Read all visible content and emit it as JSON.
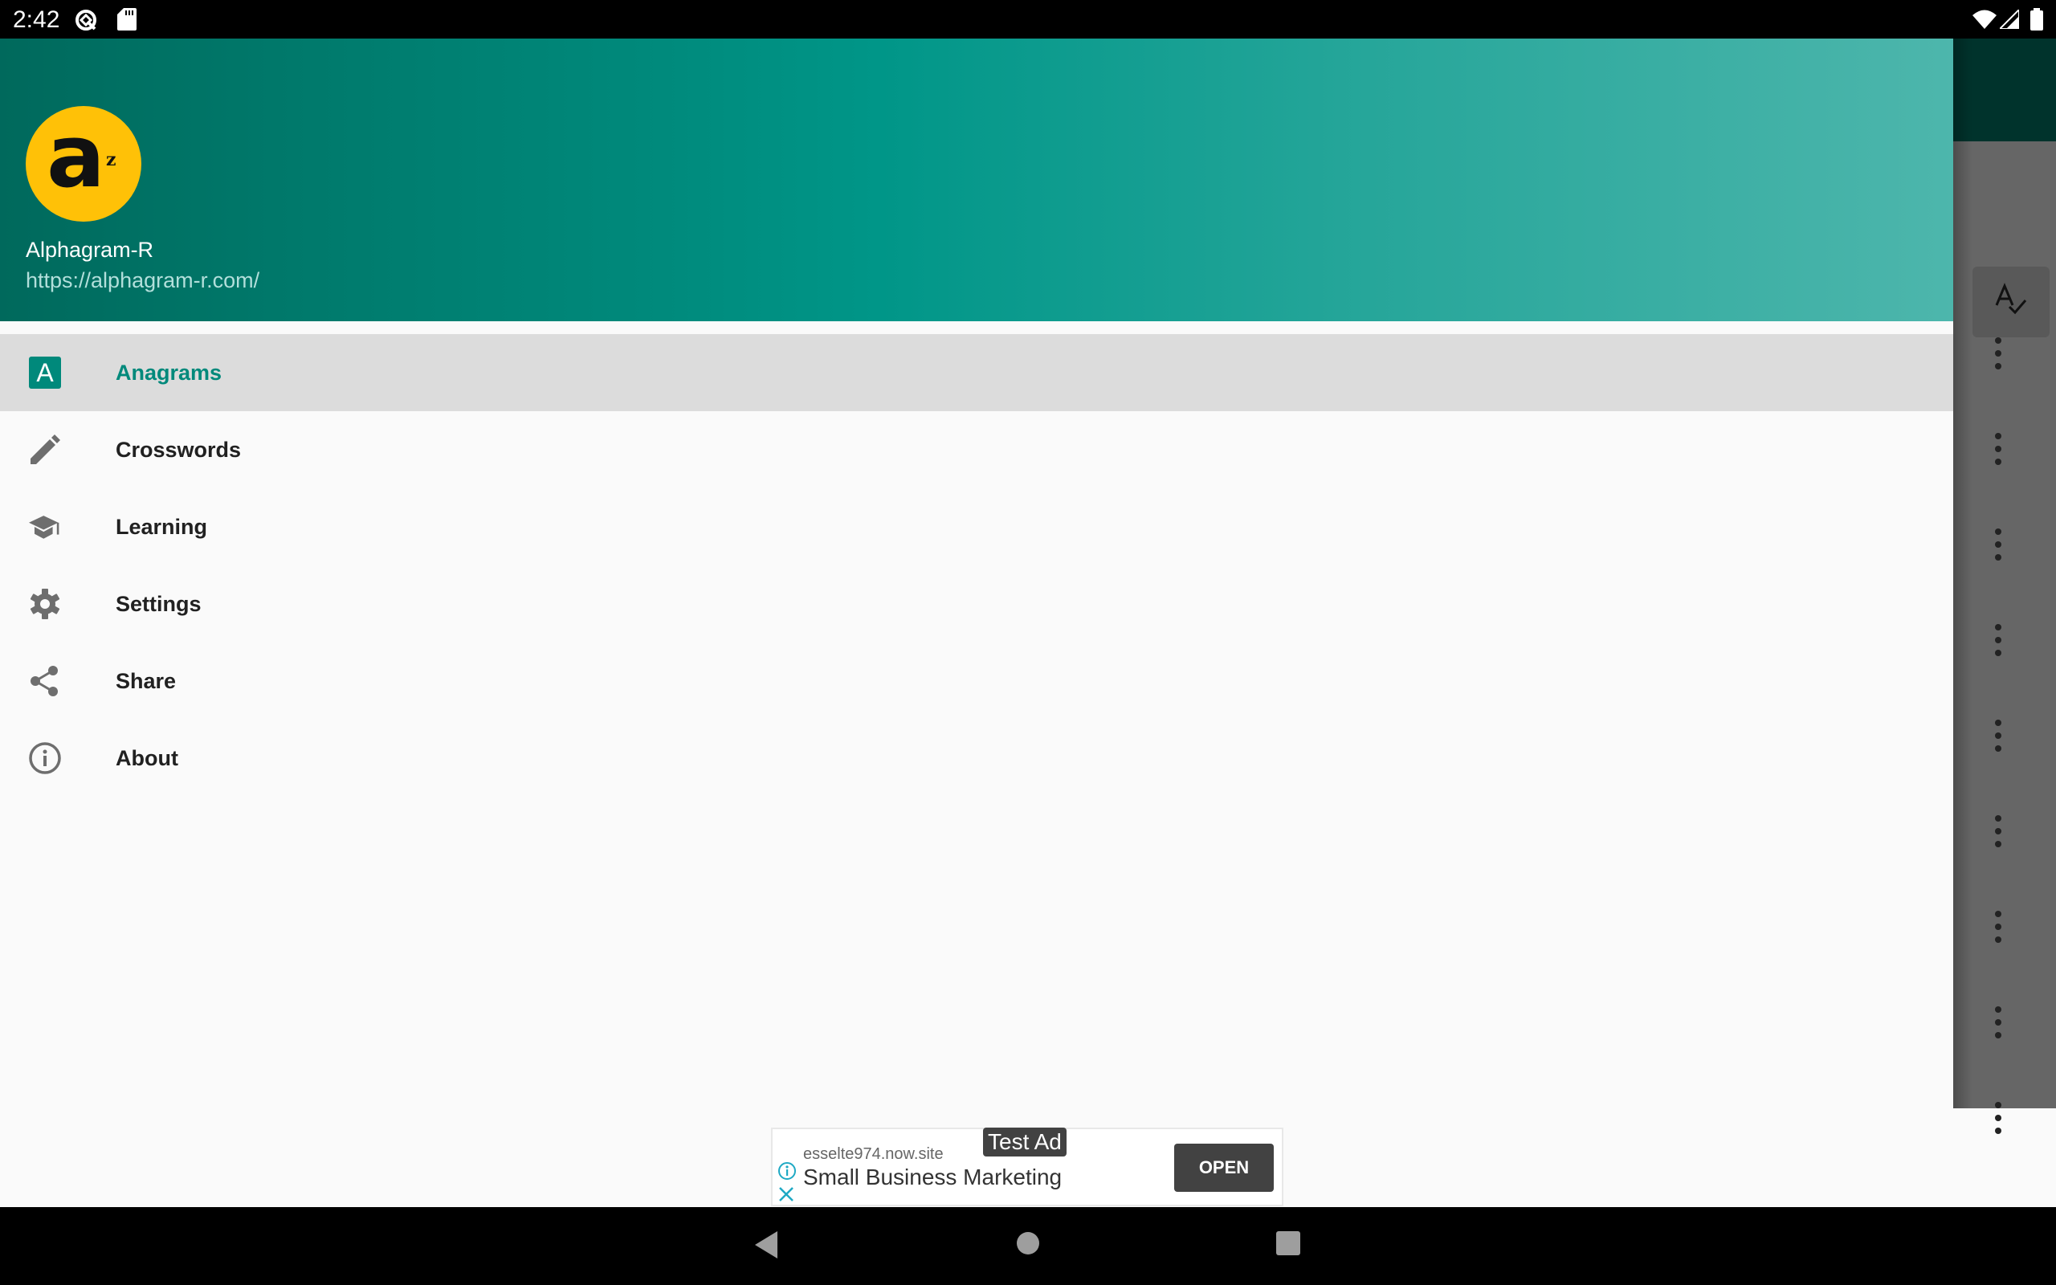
{
  "status_bar": {
    "time": "2:42",
    "left_icons": [
      "vpn-key-icon",
      "sd-card-icon"
    ],
    "right_icons": [
      "wifi-icon",
      "cell-signal-icon",
      "battery-icon"
    ]
  },
  "drawer": {
    "header": {
      "app_name": "Alphagram-R",
      "url": "https://alphagram-r.com/",
      "avatar": {
        "letter": "a",
        "superscript": "z",
        "color": "#ffc107"
      },
      "gradient_colors": [
        "#00695c",
        "#009688",
        "#4db6ac"
      ]
    },
    "menu": [
      {
        "label": "Anagrams",
        "icon": "anagram-a-icon",
        "selected": true
      },
      {
        "label": "Crosswords",
        "icon": "pencil-icon",
        "selected": false
      },
      {
        "label": "Learning",
        "icon": "school-icon",
        "selected": false
      },
      {
        "label": "Settings",
        "icon": "gear-icon",
        "selected": false
      },
      {
        "label": "Share",
        "icon": "share-icon",
        "selected": false
      },
      {
        "label": "About",
        "icon": "info-icon",
        "selected": false
      }
    ],
    "accent_color": "#00897b",
    "anagram_icon_letter": "A"
  },
  "background_app": {
    "toolbar_icon": "spellcheck-icon",
    "row_menu_icon": "more-vert-icon",
    "row_count": 9
  },
  "ad": {
    "tag": "Test Ad",
    "domain": "esselte974.now.site",
    "title": "Small Business Marketing",
    "button_label": "OPEN"
  },
  "nav_bar": {
    "buttons": [
      "back-icon",
      "home-icon",
      "recents-icon"
    ]
  }
}
